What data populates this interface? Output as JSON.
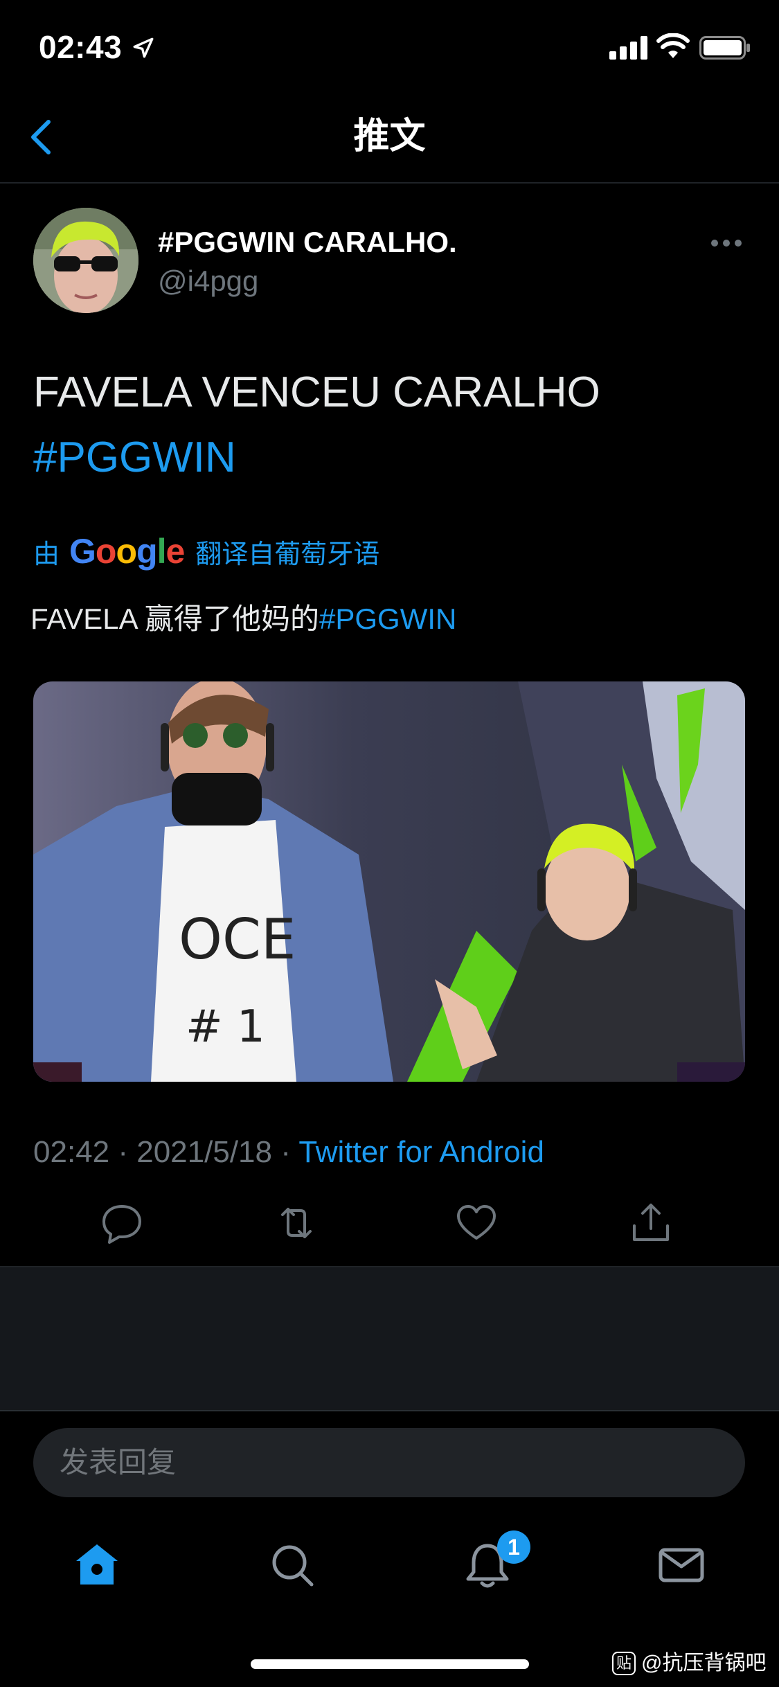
{
  "status_bar": {
    "time": "02:43",
    "icons": [
      "location-arrow-icon",
      "signal-icon",
      "wifi-icon",
      "battery-icon"
    ]
  },
  "nav": {
    "title": "推文",
    "back_icon": "chevron-left-icon"
  },
  "tweet": {
    "display_name": "#PGGWIN CARALHO.",
    "handle": "@i4pgg",
    "text_line1": "FAVELA VENCEU CARALHO",
    "hashtag": "#PGGWIN",
    "translation": {
      "prefix": "由",
      "provider": "Google",
      "suffix": "翻译自葡萄牙语",
      "text": "FAVELA 赢得了他妈的",
      "hashtag": "#PGGWIN"
    },
    "time": "02:42",
    "date": "2021/5/18",
    "source": "Twitter for Android",
    "separator": "·"
  },
  "reply": {
    "placeholder": "发表回复"
  },
  "tab_bar": {
    "items": [
      "home-icon",
      "search-icon",
      "bell-icon",
      "mail-icon"
    ],
    "notification_count": "1"
  },
  "watermark": {
    "badge": "贴",
    "text": "@抗压背锅吧"
  },
  "colors": {
    "background": "#000000",
    "accent": "#1d9bf0",
    "secondary_text": "#6e767d",
    "panel": "#15181c"
  }
}
